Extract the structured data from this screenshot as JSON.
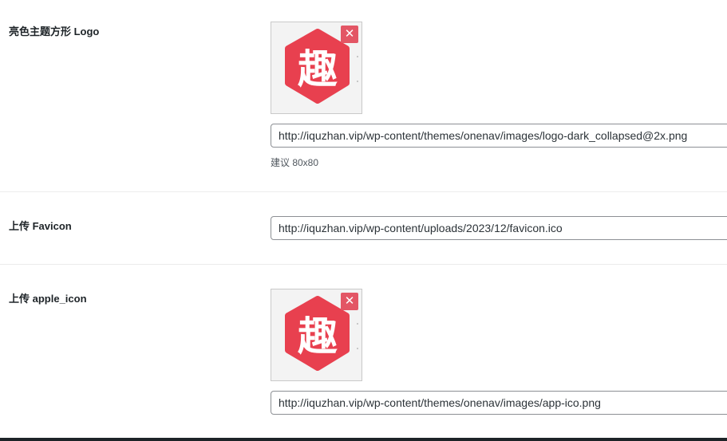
{
  "fields": {
    "logo": {
      "label": "亮色主题方形 Logo",
      "preview_glyph": "趣",
      "remove_symbol": "✕",
      "value": "http://iquzhan.vip/wp-content/themes/onenav/images/logo-dark_collapsed@2x.png",
      "hint": "建议 80x80"
    },
    "favicon": {
      "label": "上传 Favicon",
      "value": "http://iquzhan.vip/wp-content/uploads/2023/12/favicon.ico"
    },
    "apple_icon": {
      "label": "上传 apple_icon",
      "preview_glyph": "趣",
      "remove_symbol": "✕",
      "value": "http://iquzhan.vip/wp-content/themes/onenav/images/app-ico.png"
    }
  },
  "colors": {
    "logo_red": "#e8404f",
    "remove_button": "#e35665",
    "input_border": "#8c8f94",
    "separator": "#ececec"
  },
  "icons": {
    "preview": "hexagon-logo-icon",
    "remove": "close-icon"
  }
}
